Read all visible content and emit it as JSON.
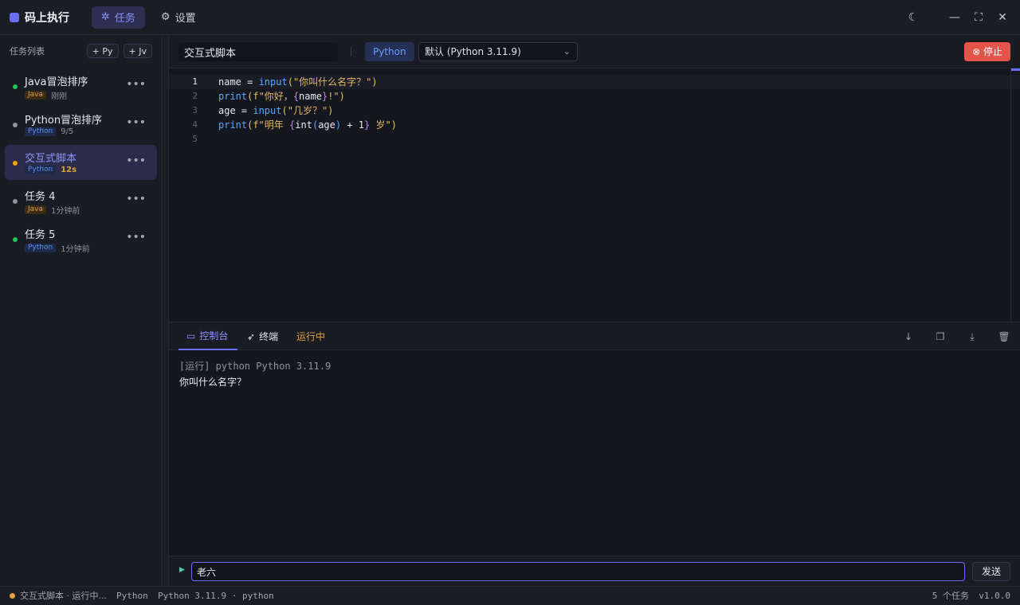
{
  "app": {
    "title": "码上执行"
  },
  "nav": {
    "tasks": "任务",
    "settings": "设置"
  },
  "sidebar": {
    "title": "任务列表",
    "add_py": "+ Py",
    "add_jv": "+ Jv",
    "items": [
      {
        "name": "Java冒泡排序",
        "lang": "Java",
        "time": "刚刚",
        "status_color": "#22c55e"
      },
      {
        "name": "Python冒泡排序",
        "lang": "Python",
        "time": "9/5",
        "status_color": "#8f929e"
      },
      {
        "name": "交互式脚本",
        "lang": "Python",
        "time": "12s",
        "status_color": "#f59e0b"
      },
      {
        "name": "任务 4",
        "lang": "Java",
        "time": "1分钟前",
        "status_color": "#8f929e"
      },
      {
        "name": "任务 5",
        "lang": "Python",
        "time": "1分钟前",
        "status_color": "#22c55e"
      }
    ]
  },
  "toolbar": {
    "task_name": "交互式脚本",
    "language": "Python",
    "runtime": "默认 (Python 3.11.9)",
    "stop": "停止"
  },
  "editor": {
    "line_numbers": [
      "1",
      "2",
      "3",
      "4",
      "5"
    ],
    "l1": {
      "a": "name = ",
      "b": "input",
      "c": "(",
      "d": "\"你叫什么名字？\"",
      "e": ")"
    },
    "l2": {
      "a": "print",
      "b": "(",
      "c": "f\"你好，",
      "d": "{",
      "e": "name",
      "f": "}",
      "g": "!\"",
      "h": ")"
    },
    "l3": {
      "a": "age = ",
      "b": "input",
      "c": "(",
      "d": "\"几岁？\"",
      "e": ")"
    },
    "l4": {
      "a": "print",
      "b": "(",
      "c": "f\"明年 ",
      "d": "{",
      "e": "int",
      "f": "(",
      "g": "age",
      "h": ")",
      "i": " + 1",
      "j": "}",
      "k": " 岁\"",
      "l": ")"
    }
  },
  "console": {
    "tab_console": "控制台",
    "tab_terminal": "终端",
    "status": "运行中",
    "lines": [
      "[运行] python Python 3.11.9",
      "你叫什么名字？"
    ],
    "input_value": "老六",
    "send": "发送"
  },
  "statusbar": {
    "task": "交互式脚本 · 运行中...",
    "lang": "Python",
    "runtime": "Python 3.11.9 · python",
    "count": "5 个任务",
    "version": "v1.0.0"
  },
  "colors": {
    "accent": "#6b6ef5",
    "danger": "#e5534b",
    "running": "#f59e0b"
  }
}
